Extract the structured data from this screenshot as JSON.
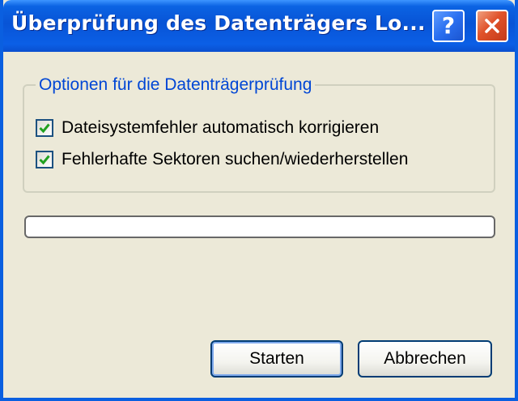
{
  "window": {
    "title": "Überprüfung des Datenträgers Lo...",
    "help_label": "?",
    "help_icon": "help-icon",
    "close_icon": "close-icon",
    "accent": "#0a5fe0"
  },
  "options": {
    "group_label": "Optionen für die Datenträgerprüfung",
    "items": [
      {
        "label": "Dateisystemfehler automatisch korrigieren",
        "checked": true
      },
      {
        "label": "Fehlerhafte Sektoren suchen/wiederherstellen",
        "checked": true
      }
    ]
  },
  "progress": {
    "value": 0
  },
  "buttons": {
    "start": "Starten",
    "cancel": "Abbrechen"
  }
}
